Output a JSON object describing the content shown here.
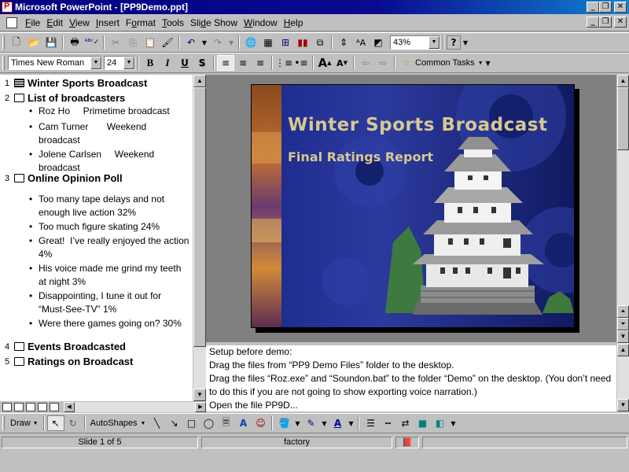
{
  "window": {
    "title": "Microsoft PowerPoint - [PP9Demo.ppt]",
    "controls": [
      "_",
      "❐",
      "✕"
    ]
  },
  "menu": {
    "items": [
      {
        "key": "F",
        "rest": "ile"
      },
      {
        "key": "E",
        "rest": "dit"
      },
      {
        "key": "V",
        "rest": "iew"
      },
      {
        "key": "I",
        "rest": "nsert"
      },
      {
        "key": "",
        "rest": "Format",
        "pre": "F",
        "k2": "o",
        "post": "rmat"
      },
      {
        "key": "T",
        "rest": "ools"
      },
      {
        "key": "",
        "pre": "Sli",
        "k2": "d",
        "post": "e Show"
      },
      {
        "key": "W",
        "rest": "indow"
      },
      {
        "key": "H",
        "rest": "elp"
      }
    ]
  },
  "standard_toolbar": {
    "zoom": "43%",
    "help_icon": "?"
  },
  "formatting_toolbar": {
    "font": "Times New Roman",
    "size": "24",
    "bold": "B",
    "italic": "I",
    "underline": "U",
    "shadow": "S",
    "common_tasks": "Common Tasks"
  },
  "outline": {
    "slides": [
      {
        "num": "1",
        "title": "Winter Sports Broadcast",
        "bullets": []
      },
      {
        "num": "2",
        "title": "List of broadcasters",
        "bullets": [
          "Roz Ho     Primetime broadcast",
          "Cam Turner       Weekend broadcast",
          "Jolene Carlsen     Weekend broadcast"
        ]
      },
      {
        "num": "3",
        "title": "Online Opinion Poll",
        "bullets": [
          "Too many tape delays and not enough live action 32%",
          "Too much figure skating 24%",
          "Great!  I’ve really enjoyed the action 4%",
          "His voice made me grind my teeth at night 3%",
          "Disappointing, I tune it out for “Must-See-TV” 1%",
          "Were there games going on? 30%"
        ]
      },
      {
        "num": "4",
        "title": "Events Broadcasted",
        "bullets": []
      },
      {
        "num": "5",
        "title": "Ratings on Broadcast",
        "bullets": []
      }
    ]
  },
  "slide": {
    "title": "Winter Sports Broadcast",
    "subtitle": "Final Ratings Report",
    "title_color": "#d8c890"
  },
  "notes": {
    "lines": [
      "Setup before demo:",
      "Drag the files from “PP9 Demo Files” folder to the desktop.",
      "Drag the files “Roz.exe” and “Soundon.bat” to the folder “Demo” on the desktop. (You don’t need to do this if you are not going to show exporting voice narration.)",
      "Open the file PP9D..."
    ]
  },
  "drawing_toolbar": {
    "draw": "Draw",
    "autoshapes": "AutoShapes"
  },
  "status": {
    "slide": "Slide 1 of 5",
    "design": "factory"
  }
}
